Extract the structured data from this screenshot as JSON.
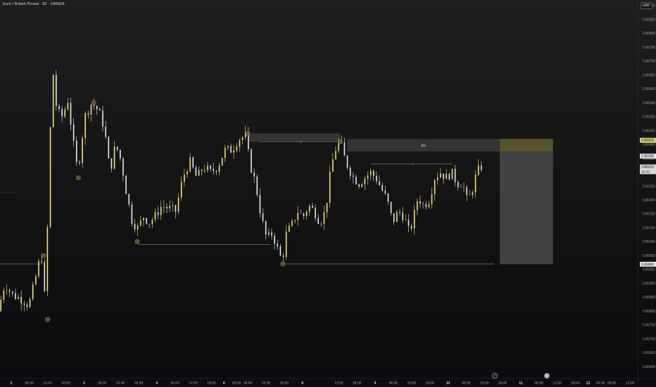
{
  "header": {
    "title": "Euro / British Pound · 30 · OANDA",
    "currency": "GBP"
  },
  "colors": {
    "up": "#f2e08a",
    "down": "#e8e8e8",
    "zone": "#3a3a3a",
    "target_zone": "#5c5a2e",
    "sl_zone": "#4a4a4a",
    "line": "#8a8a8a",
    "current_price_bg": "#d9d9d9",
    "pivot_dot": "#6a5a3a"
  },
  "chart_data": {
    "type": "candlestick",
    "instrument": "Euro / British Pound",
    "timeframe": "30",
    "source": "OANDA",
    "ylim": [
      0.8556,
      0.8692
    ],
    "y_ticks": [
      "0.86900",
      "0.86850",
      "0.86800",
      "0.86750",
      "0.86700",
      "0.86650",
      "0.86600",
      "0.86550",
      "0.86500",
      "0.86450",
      "0.86400",
      "0.86350",
      "0.86300",
      "0.86250",
      "0.86200",
      "0.86150",
      "0.86100",
      "0.86050",
      "0.86000",
      "0.85950",
      "0.85900",
      "0.85850",
      "0.85800",
      "0.85750",
      "0.85700",
      "0.85650",
      "0.85600"
    ],
    "x_ticks": [
      {
        "label": "2",
        "t": 0.08,
        "bold": true
      },
      {
        "label": "06:00",
        "t": 0.21,
        "bold": false
      },
      {
        "label": "12:00",
        "t": 0.34,
        "bold": false
      },
      {
        "label": "18:00",
        "t": 0.47,
        "bold": false
      },
      {
        "label": "3",
        "t": 0.6,
        "bold": true
      },
      {
        "label": "06:00",
        "t": 0.73,
        "bold": false
      },
      {
        "label": "12:00",
        "t": 0.86,
        "bold": false
      },
      {
        "label": "18:00",
        "t": 0.99,
        "bold": false
      },
      {
        "label": "4",
        "t": 1.12,
        "bold": true
      },
      {
        "label": "06:00",
        "t": 1.25,
        "bold": false
      },
      {
        "label": "12:00",
        "t": 1.38,
        "bold": false
      },
      {
        "label": "18:00",
        "t": 1.51,
        "bold": false
      },
      {
        "label": "6",
        "t": 1.6,
        "bold": true
      },
      {
        "label": "02:00",
        "t": 1.69,
        "bold": false
      },
      {
        "label": "06:00",
        "t": 1.77,
        "bold": false
      },
      {
        "label": "12:00",
        "t": 1.9,
        "bold": false
      },
      {
        "label": "18:00",
        "t": 2.03,
        "bold": false
      },
      {
        "label": "8",
        "t": 2.16,
        "bold": true
      },
      {
        "label": "12:00",
        "t": 2.42,
        "bold": false
      },
      {
        "label": "18:00",
        "t": 2.55,
        "bold": false
      },
      {
        "label": "9",
        "t": 2.68,
        "bold": true
      },
      {
        "label": "06:00",
        "t": 2.81,
        "bold": false
      },
      {
        "label": "12:00",
        "t": 2.94,
        "bold": false
      },
      {
        "label": "18:00",
        "t": 3.07,
        "bold": false
      },
      {
        "label": "10",
        "t": 3.2,
        "bold": true
      },
      {
        "label": "06:00",
        "t": 3.33,
        "bold": false
      },
      {
        "label": "12:00",
        "t": 3.46,
        "bold": false
      },
      {
        "label": "18:00",
        "t": 3.59,
        "bold": false
      },
      {
        "label": "11",
        "t": 3.72,
        "bold": true
      },
      {
        "label": "06:00",
        "t": 3.85,
        "bold": false
      },
      {
        "label": "12:00",
        "t": 3.98,
        "bold": false
      },
      {
        "label": "18:00",
        "t": 4.11,
        "bold": false
      },
      {
        "label": "13",
        "t": 4.2,
        "bold": true
      },
      {
        "label": "02:00",
        "t": 4.29,
        "bold": false
      },
      {
        "label": "06:00",
        "t": 4.37,
        "bold": false
      },
      {
        "label": "12:00",
        "t": 4.5,
        "bold": false
      }
    ],
    "path_points": [
      [
        0.0,
        0.858
      ],
      [
        0.05,
        0.859
      ],
      [
        0.1,
        0.8586
      ],
      [
        0.18,
        0.8584
      ],
      [
        0.22,
        0.8582
      ],
      [
        0.26,
        0.859
      ],
      [
        0.29,
        0.8597
      ],
      [
        0.32,
        0.86
      ],
      [
        0.34,
        0.8578
      ],
      [
        0.36,
        0.8625
      ],
      [
        0.39,
        0.8668
      ],
      [
        0.42,
        0.8652
      ],
      [
        0.46,
        0.865
      ],
      [
        0.5,
        0.8656
      ],
      [
        0.54,
        0.864
      ],
      [
        0.57,
        0.863
      ],
      [
        0.62,
        0.865
      ],
      [
        0.67,
        0.8655
      ],
      [
        0.72,
        0.8652
      ],
      [
        0.76,
        0.8646
      ],
      [
        0.8,
        0.863
      ],
      [
        0.84,
        0.864
      ],
      [
        0.88,
        0.8634
      ],
      [
        0.92,
        0.8622
      ],
      [
        0.96,
        0.8612
      ],
      [
        1.0,
        0.861
      ],
      [
        1.04,
        0.8614
      ],
      [
        1.08,
        0.8612
      ],
      [
        1.12,
        0.8614
      ],
      [
        1.17,
        0.8618
      ],
      [
        1.22,
        0.8617
      ],
      [
        1.27,
        0.8616
      ],
      [
        1.32,
        0.8628
      ],
      [
        1.37,
        0.8634
      ],
      [
        1.42,
        0.8628
      ],
      [
        1.47,
        0.8632
      ],
      [
        1.52,
        0.863
      ],
      [
        1.57,
        0.8632
      ],
      [
        1.62,
        0.8638
      ],
      [
        1.67,
        0.8638
      ],
      [
        1.72,
        0.8642
      ],
      [
        1.77,
        0.8643
      ],
      [
        1.8,
        0.8633
      ],
      [
        1.84,
        0.8626
      ],
      [
        1.88,
        0.8614
      ],
      [
        1.92,
        0.8606
      ],
      [
        1.96,
        0.8608
      ],
      [
        2.0,
        0.8602
      ],
      [
        2.03,
        0.8598
      ],
      [
        2.06,
        0.8608
      ],
      [
        2.1,
        0.8611
      ],
      [
        2.14,
        0.8616
      ],
      [
        2.18,
        0.8614
      ],
      [
        2.22,
        0.8618
      ],
      [
        2.26,
        0.8616
      ],
      [
        2.3,
        0.8612
      ],
      [
        2.34,
        0.8616
      ],
      [
        2.38,
        0.8632
      ],
      [
        2.41,
        0.8638
      ],
      [
        2.44,
        0.8642
      ],
      [
        2.47,
        0.8636
      ],
      [
        2.5,
        0.8632
      ],
      [
        2.54,
        0.8628
      ],
      [
        2.58,
        0.8626
      ],
      [
        2.62,
        0.8628
      ],
      [
        2.66,
        0.863
      ],
      [
        2.7,
        0.8628
      ],
      [
        2.74,
        0.8624
      ],
      [
        2.78,
        0.862
      ],
      [
        2.82,
        0.8612
      ],
      [
        2.86,
        0.8616
      ],
      [
        2.9,
        0.8614
      ],
      [
        2.94,
        0.8608
      ],
      [
        2.97,
        0.8614
      ],
      [
        3.0,
        0.8621
      ],
      [
        3.04,
        0.8618
      ],
      [
        3.08,
        0.862
      ],
      [
        3.12,
        0.8628
      ],
      [
        3.16,
        0.863
      ],
      [
        3.2,
        0.8628
      ],
      [
        3.24,
        0.863
      ],
      [
        3.28,
        0.8626
      ],
      [
        3.32,
        0.8626
      ],
      [
        3.35,
        0.862
      ],
      [
        3.38,
        0.8622
      ],
      [
        3.42,
        0.863
      ],
      [
        3.45,
        0.8632
      ]
    ],
    "horizontal_levels": [
      {
        "name": "swing-low-1",
        "y": 0.8604,
        "t_start": 0.99,
        "t_end": 1.93
      },
      {
        "name": "swing-low-2",
        "y": 0.8597,
        "t_start": 2.02,
        "t_end": 3.53
      },
      {
        "name": "left-level",
        "y": 0.8597,
        "t_start": 0.0,
        "t_end": 0.3
      },
      {
        "name": "swing-high-1",
        "y": 0.8641,
        "t_start": 1.85,
        "t_end": 2.43
      },
      {
        "name": "swing-high-2",
        "y": 0.8633,
        "t_start": 2.65,
        "t_end": 3.23
      }
    ],
    "zones": [
      {
        "name": "supply-zone-1",
        "y_top": 0.8644,
        "y_bottom": 0.8641,
        "t_start": 1.78,
        "t_end": 2.43,
        "label": ""
      },
      {
        "name": "supply-zone-2",
        "y_top": 0.8642,
        "y_bottom": 0.86375,
        "t_start": 2.48,
        "t_end": 3.57,
        "label": "Abl"
      }
    ],
    "position": {
      "entry": 0.86375,
      "target": 0.8642,
      "stop_zone_bottom": 0.85969,
      "t_start": 3.57,
      "t_end": 3.95
    },
    "pivot_markers": [
      {
        "t": 0.56,
        "y": 0.8628
      },
      {
        "t": 0.34,
        "y": 0.8577
      },
      {
        "t": 0.31,
        "y": 0.86
      },
      {
        "t": 0.67,
        "y": 0.8655
      },
      {
        "t": 0.98,
        "y": 0.8605
      },
      {
        "t": 1.77,
        "y": 0.8644
      },
      {
        "t": 2.02,
        "y": 0.8597
      },
      {
        "t": 2.43,
        "y": 0.8641
      }
    ],
    "price_labels": [
      {
        "text": "0.86415",
        "y": 0.86415,
        "style": "target"
      },
      {
        "text": "0.86358",
        "y": 0.86358,
        "style": "neutral"
      },
      {
        "text": "0.86319",
        "y": 0.86319,
        "style": "current"
      },
      {
        "text": "16:41",
        "y": 0.86302,
        "style": "current-sub"
      },
      {
        "text": "0.85969",
        "y": 0.85969,
        "style": "neutral"
      }
    ],
    "annotations": [
      "Abl"
    ]
  }
}
